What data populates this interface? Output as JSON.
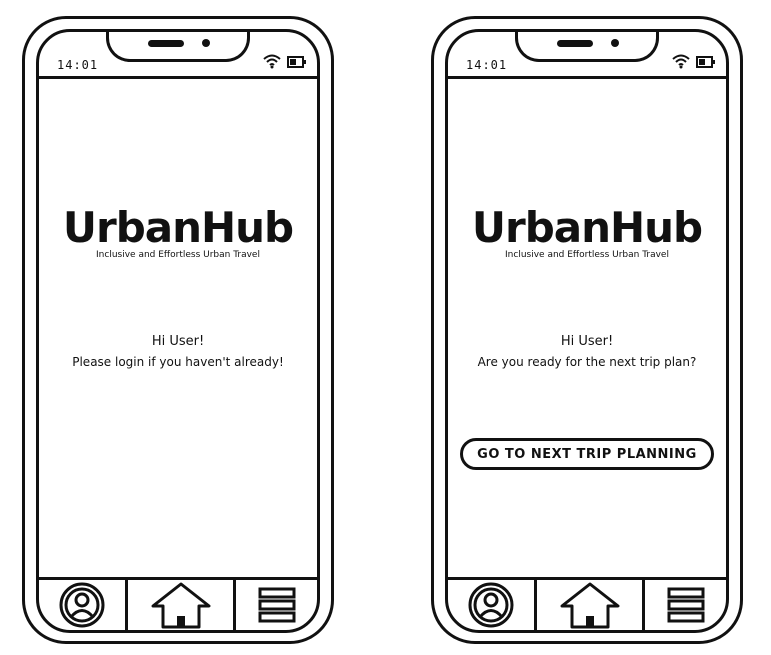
{
  "screens": [
    {
      "status_time": "14:01",
      "logo": "UrbanHub",
      "tagline": "Inclusive and Effortless Urban Travel",
      "greeting": "Hi User!",
      "message": "Please login if you haven't already!"
    },
    {
      "status_time": "14:01",
      "logo": "UrbanHub",
      "tagline": "Inclusive and Effortless Urban Travel",
      "greeting": "Hi User!",
      "message": "Are you ready for the next trip plan?",
      "cta_label": "GO TO NEXT TRIP PLANNING"
    }
  ],
  "tab_bar": {
    "icons": [
      "profile-icon",
      "home-icon",
      "menu-icon"
    ]
  }
}
